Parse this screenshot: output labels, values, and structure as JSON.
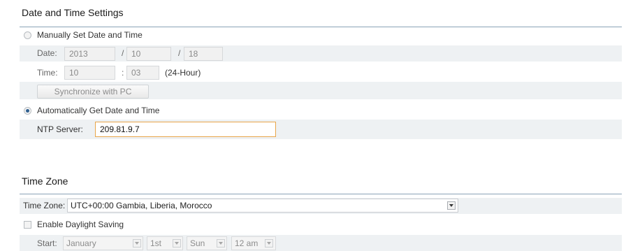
{
  "datetime": {
    "title": "Date and Time Settings",
    "manual_label": "Manually Set Date and Time",
    "manual_selected": false,
    "date_label": "Date:",
    "date_year": "2013",
    "date_sep1": "/",
    "date_month": "10",
    "date_sep2": "/",
    "date_day": "18",
    "time_label": "Time:",
    "time_hour": "10",
    "time_sep": ":",
    "time_minute": "03",
    "time_format": "(24-Hour)",
    "sync_button": "Synchronize with PC",
    "auto_label": "Automatically Get Date and Time",
    "auto_selected": true,
    "ntp_label": "NTP Server:",
    "ntp_value": "209.81.9.7"
  },
  "timezone": {
    "title": "Time Zone",
    "tz_label": "Time Zone:",
    "tz_value": "UTC+00:00 Gambia, Liberia, Morocco",
    "dst_label": "Enable Daylight Saving",
    "dst_enabled": false,
    "start_label": "Start:",
    "start_month": "January",
    "start_week": "1st",
    "start_day": "Sun",
    "start_time": "12 am"
  },
  "colors": {
    "divider": "#8aa3b6",
    "row_bg": "#eef1f3",
    "focus_border": "#e8a64a",
    "radio_dot": "#2f5f8f"
  }
}
